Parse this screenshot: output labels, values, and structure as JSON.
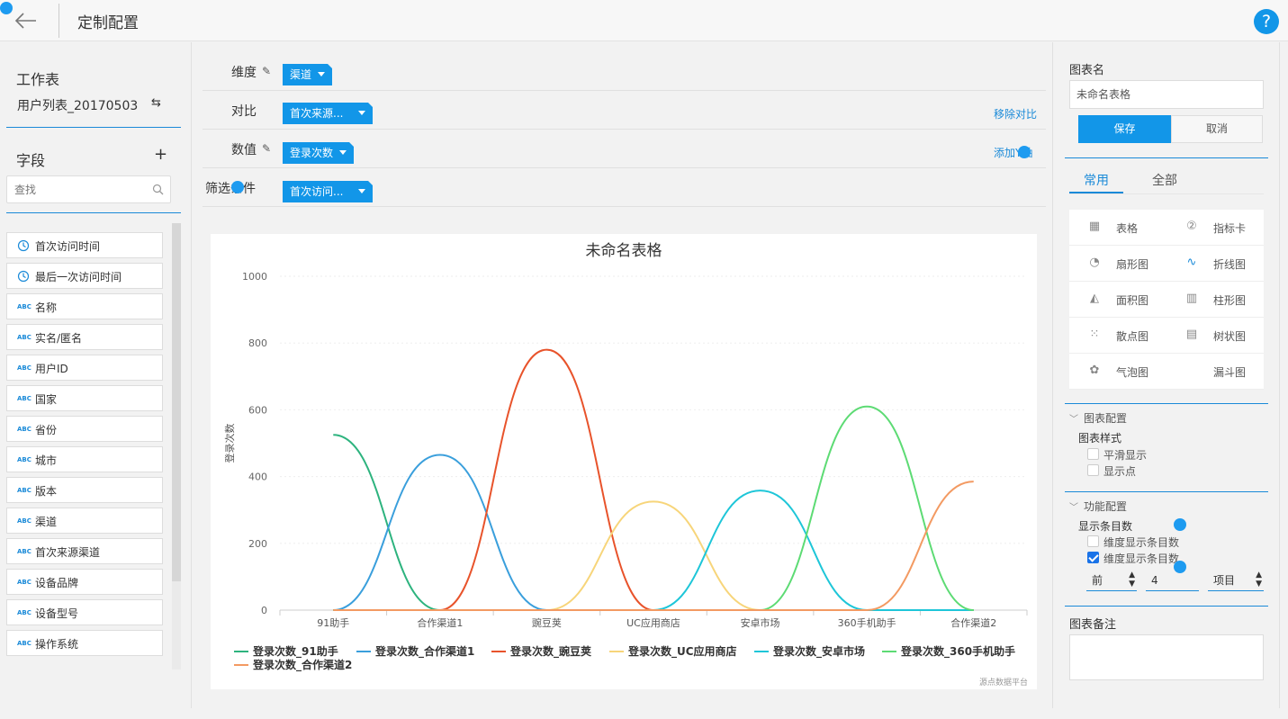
{
  "header": {
    "title": "定制配置",
    "help": "?"
  },
  "left": {
    "worksheet_title": "工作表",
    "worksheet_name": "用户列表_20170503",
    "fields_title": "字段",
    "search_placeholder": "查找",
    "fields": [
      {
        "type": "time",
        "label": "首次访问时间"
      },
      {
        "type": "time",
        "label": "最后一次访问时间"
      },
      {
        "type": "abc",
        "label": "名称"
      },
      {
        "type": "abc",
        "label": "实名/匿名"
      },
      {
        "type": "abc",
        "label": "用户ID"
      },
      {
        "type": "abc",
        "label": "国家"
      },
      {
        "type": "abc",
        "label": "省份"
      },
      {
        "type": "abc",
        "label": "城市"
      },
      {
        "type": "abc",
        "label": "版本"
      },
      {
        "type": "abc",
        "label": "渠道"
      },
      {
        "type": "abc",
        "label": "首次来源渠道"
      },
      {
        "type": "abc",
        "label": "设备品牌"
      },
      {
        "type": "abc",
        "label": "设备型号"
      },
      {
        "type": "abc",
        "label": "操作系统"
      }
    ]
  },
  "config": {
    "dimension_label": "维度",
    "dimension_value": "渠道",
    "compare_label": "对比",
    "compare_value": "首次来源...",
    "remove_compare": "移除对比",
    "measure_label": "数值",
    "measure_value": "登录次数",
    "add_axis": "添加Y轴",
    "filter_label": "筛选条件",
    "filter_value": "首次访问..."
  },
  "chart_data": {
    "type": "line",
    "title": "未命名表格",
    "ylabel": "登录次数",
    "xlabel": "",
    "ylim": [
      0,
      1000
    ],
    "yticks": [
      0,
      200,
      400,
      600,
      800,
      1000
    ],
    "categories": [
      "91助手",
      "合作渠道1",
      "豌豆荚",
      "UC应用商店",
      "安卓市场",
      "360手机助手",
      "合作渠道2"
    ],
    "series": [
      {
        "name": "登录次数_91助手",
        "color": "#2db37e",
        "values": [
          525,
          0,
          0,
          0,
          0,
          0,
          0
        ]
      },
      {
        "name": "登录次数_合作渠道1",
        "color": "#3a9fdc",
        "values": [
          0,
          465,
          0,
          0,
          0,
          0,
          0
        ]
      },
      {
        "name": "登录次数_豌豆荚",
        "color": "#e8532b",
        "values": [
          0,
          0,
          780,
          0,
          0,
          0,
          0
        ]
      },
      {
        "name": "登录次数_UC应用商店",
        "color": "#f7d57a",
        "values": [
          0,
          0,
          0,
          325,
          0,
          0,
          0
        ]
      },
      {
        "name": "登录次数_安卓市场",
        "color": "#1ec6d8",
        "values": [
          0,
          0,
          0,
          0,
          358,
          0,
          0
        ]
      },
      {
        "name": "登录次数_360手机助手",
        "color": "#5ddb74",
        "values": [
          0,
          0,
          0,
          0,
          0,
          610,
          0
        ]
      },
      {
        "name": "登录次数_合作渠道2",
        "color": "#f39a62",
        "values": [
          0,
          0,
          0,
          0,
          0,
          0,
          385
        ]
      }
    ],
    "watermark": "源点数据平台",
    "grid": true,
    "legend": "bottom"
  },
  "right": {
    "chart_name_title": "图表名",
    "chart_name_value": "未命名表格",
    "save": "保存",
    "cancel": "取消",
    "tab_common": "常用",
    "tab_all": "全部",
    "chart_types": [
      {
        "icon": "table-icon",
        "glyph": "▦",
        "label": "表格"
      },
      {
        "icon": "kpi-card-icon",
        "glyph": "②",
        "label": "指标卡"
      },
      {
        "icon": "pie-chart-icon",
        "glyph": "◔",
        "label": "扇形图"
      },
      {
        "icon": "line-chart-icon",
        "glyph": "∿",
        "label": "折线图"
      },
      {
        "icon": "area-chart-icon",
        "glyph": "◭",
        "label": "面积图"
      },
      {
        "icon": "bar-chart-icon",
        "glyph": "▥",
        "label": "柱形图"
      },
      {
        "icon": "scatter-chart-icon",
        "glyph": "⁙",
        "label": "散点图"
      },
      {
        "icon": "tree-chart-icon",
        "glyph": "▤",
        "label": "树状图"
      },
      {
        "icon": "bubble-chart-icon",
        "glyph": "✿",
        "label": "气泡图"
      },
      {
        "icon": "funnel-chart-icon",
        "glyph": "",
        "label": "漏斗图"
      }
    ],
    "chart_config_title": "图表配置",
    "chart_style_title": "图表样式",
    "smooth_label": "平滑显示",
    "show_points_label": "显示点",
    "func_config_title": "功能配置",
    "display_count_title": "显示条目数",
    "dim_count_label_1": "维度显示条目数",
    "dim_count_label_2": "维度显示条目数",
    "order_value": "前",
    "count_value": "4",
    "unit_value": "项目",
    "note_title": "图表备注"
  }
}
